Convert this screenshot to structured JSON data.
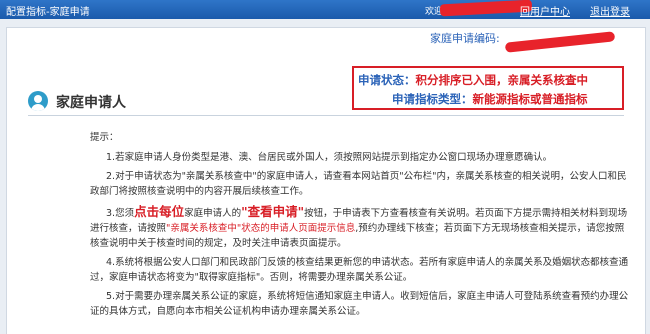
{
  "header": {
    "title": "配置指标-家庭申请",
    "welcome": "欢迎",
    "user_center": "回用户中心",
    "logout": "退出登录"
  },
  "application": {
    "number_label": "家庭申请编码:",
    "status_label": "申请状态：",
    "status_value": "积分排序已入围，亲属关系核查中",
    "type_label": "申请指标类型：",
    "type_value": "新能源指标或普通指标"
  },
  "section": {
    "title": "家庭申请人"
  },
  "notes": {
    "hint": "提示：",
    "p1": "1.若家庭申请人身份类型是港、澳、台居民或外国人，须按照网站提示到指定办公窗口现场办理意愿确认。",
    "p2": "2.对于申请状态为\"亲属关系核查中\"的家庭申请人，请查看本网站首页\"公布栏\"内，亲属关系核查的相关说明，公安人口和民政部门将按照核查说明中的内容开展后续核查工作。",
    "p3_a": "3.您须",
    "p3_big": "点击每位",
    "p3_b": "家庭申请人的",
    "p3_big2": "\"查看申请\"",
    "p3_c": "按钮，于申请表下方查看核查有关说明。若页面下方提示需持相关材料到现场进行核查，请按照",
    "p3_red": "\"亲属关系核查中\"状态的申请人页面提示信息",
    "p3_d": ",预约办理线下核查；若页面下方无现场核查相关提示，请您按照核查说明中关于核查时间的规定，及时关注申请表页面提示。",
    "p4": "4.系统将根据公安人口部门和民政部门反馈的核查结果更新您的申请状态。若所有家庭申请人的亲属关系及婚姻状态都核查通过，家庭申请状态将变为\"取得家庭指标\"。否则，将需要办理亲属关系公证。",
    "p5": "5.对于需要办理亲属关系公证的家庭，系统将短信通知家庭主申请人。收到短信后，家庭主申请人可登陆系统查看预约办理公证的具体方式，自愿向本市相关公证机构申请办理亲属关系公证。"
  },
  "colors": {
    "header_blue": "#1a5aab",
    "status_red": "#d81e26",
    "label_blue": "#2b63b8"
  }
}
